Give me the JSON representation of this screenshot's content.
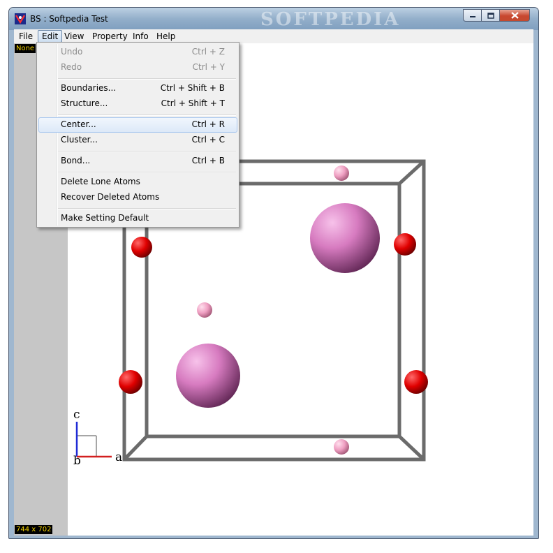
{
  "window": {
    "title": "BS  : Softpedia Test",
    "watermark": "SOFTPEDIA",
    "controls": {
      "minimize": "minimize",
      "maximize": "maximize",
      "close": "close"
    }
  },
  "menubar": {
    "items": [
      {
        "label": "File"
      },
      {
        "label": "Edit"
      },
      {
        "label": "View"
      },
      {
        "label": "Property"
      },
      {
        "label": "Info"
      },
      {
        "label": "Help"
      }
    ]
  },
  "edit_menu": {
    "items": [
      {
        "label": "Undo",
        "shortcut": "Ctrl + Z",
        "enabled": false
      },
      {
        "label": "Redo",
        "shortcut": "Ctrl + Y",
        "enabled": false
      },
      {
        "label": "Boundaries...",
        "shortcut": "Ctrl + Shift + B",
        "enabled": true
      },
      {
        "label": "Structure...",
        "shortcut": "Ctrl + Shift + T",
        "enabled": true
      },
      {
        "label": "Center...",
        "shortcut": "Ctrl + R",
        "enabled": true,
        "highlighted": true
      },
      {
        "label": "Cluster...",
        "shortcut": "Ctrl + C",
        "enabled": true
      },
      {
        "label": "Bond...",
        "shortcut": "Ctrl + B",
        "enabled": true
      },
      {
        "label": "Delete Lone Atoms",
        "shortcut": "",
        "enabled": true
      },
      {
        "label": "Recover Deleted Atoms",
        "shortcut": "",
        "enabled": true
      },
      {
        "label": "Make Setting Default",
        "shortcut": "",
        "enabled": true
      }
    ]
  },
  "viewport": {
    "selection_badge": "None",
    "size_badge": "744 x 702",
    "axes": {
      "c": "c",
      "a": "a",
      "b": "b"
    },
    "colors": {
      "cell_edge": "#6b6b6b",
      "atom_large": "#d77bc0",
      "atom_small": "#ef9fc2",
      "atom_red": "#e00000",
      "axis_c": "#1f2bd6",
      "axis_a": "#d21f1f"
    }
  }
}
